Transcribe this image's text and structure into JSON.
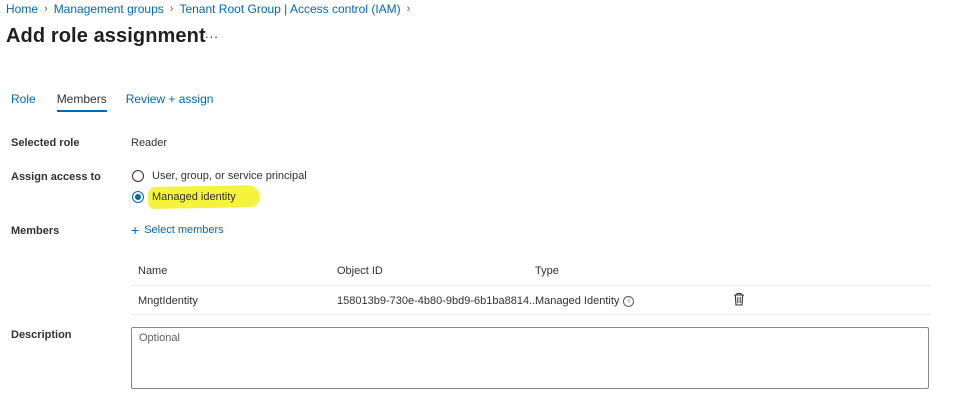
{
  "breadcrumb": {
    "items": [
      "Home",
      "Management groups",
      "Tenant Root Group | Access control (IAM)"
    ],
    "separator": ">"
  },
  "page": {
    "title": "Add role assignment",
    "more_label": "..."
  },
  "tabs": [
    {
      "label": "Role",
      "active": false
    },
    {
      "label": "Members",
      "active": true
    },
    {
      "label": "Review + assign",
      "active": false
    }
  ],
  "form": {
    "selected_role_label": "Selected role",
    "selected_role_value": "Reader",
    "assign_access_label": "Assign access to",
    "assign_options": [
      {
        "label": "User, group, or service principal",
        "selected": false
      },
      {
        "label": "Managed identity",
        "selected": true
      }
    ],
    "members_label": "Members",
    "select_members_label": "Select members",
    "description_label": "Description",
    "description_placeholder": "Optional"
  },
  "members_table": {
    "columns": [
      "Name",
      "Object ID",
      "Type"
    ],
    "rows": [
      {
        "name": "MngtIdentity",
        "object_id": "158013b9-730e-4b80-9bd9-6b1ba8814...",
        "type": "Managed Identity"
      }
    ]
  },
  "colors": {
    "accent": "#0067b8",
    "highlight": "#f5f233",
    "text": "#323130"
  }
}
